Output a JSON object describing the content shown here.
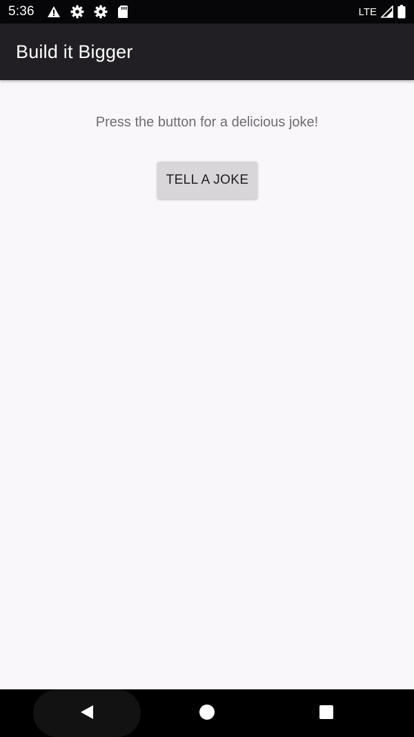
{
  "status_bar": {
    "time": "5:36",
    "network": "LTE",
    "icons": [
      "warning-icon",
      "settings-icon",
      "settings-icon",
      "sd-card-icon",
      "signal-icon",
      "battery-icon"
    ]
  },
  "app_bar": {
    "title": "Build it Bigger"
  },
  "main": {
    "prompt": "Press the button for a delicious joke!",
    "button_label": "TELL A JOKE"
  },
  "nav_bar": {
    "icons": [
      "back-icon",
      "home-icon",
      "recents-icon"
    ]
  },
  "colors": {
    "status_bar_bg": "#060608",
    "app_bar_bg": "#211f23",
    "background": "#f9f7fa",
    "button_bg": "#d8d6d9",
    "prompt_text": "#6f6b72"
  }
}
